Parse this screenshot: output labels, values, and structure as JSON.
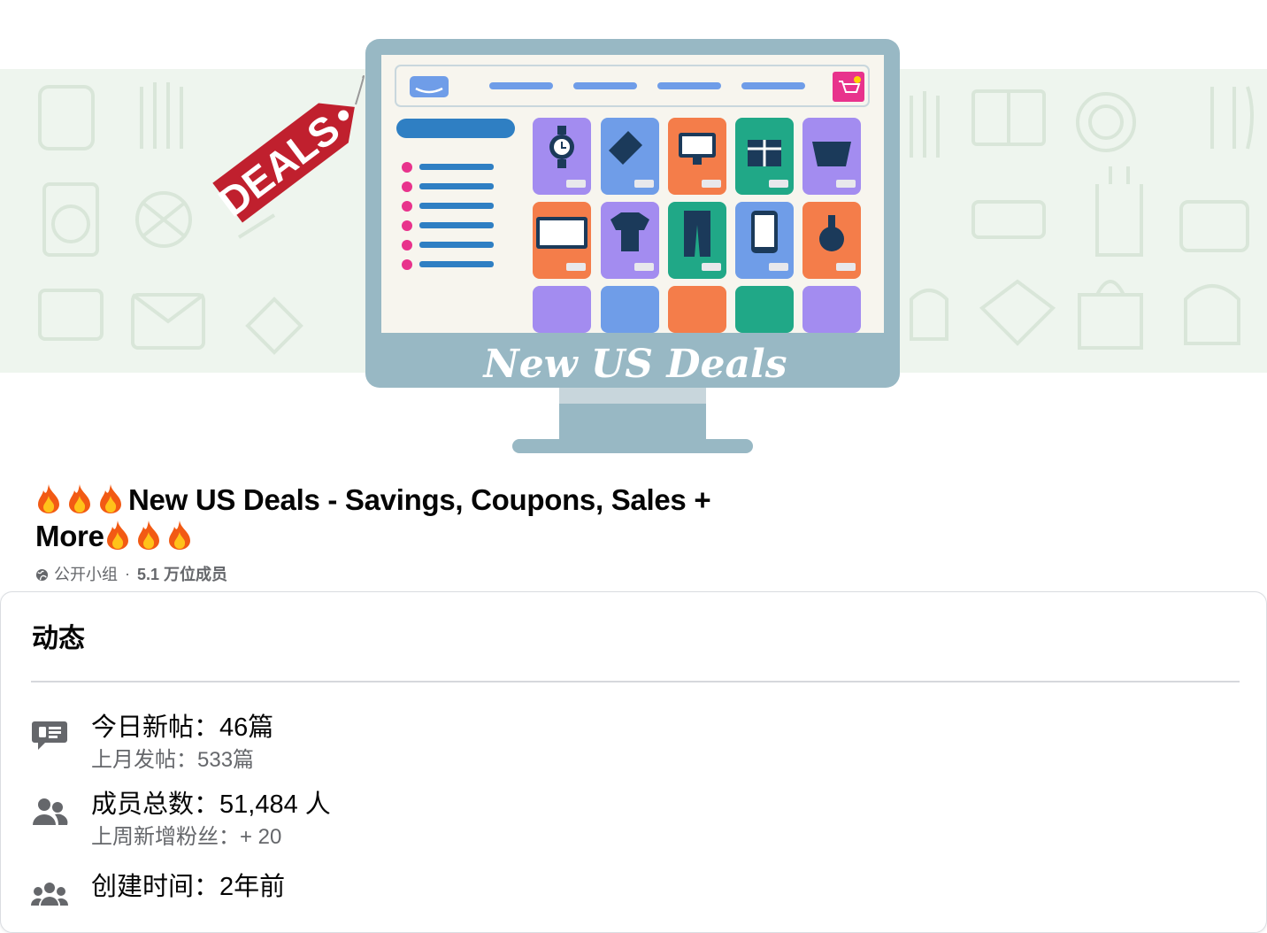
{
  "cover": {
    "tag_text": "DEALS",
    "screen_caption": "New US Deals"
  },
  "group": {
    "title_prefix_emoji": "🔥🔥🔥",
    "title_line1": "New US Deals - Savings, Coupons, Sales +",
    "title_line2": "More",
    "title_suffix_emoji": "🔥🔥🔥",
    "privacy": "公开小组",
    "separator": "·",
    "members": "5.1 万位成员"
  },
  "activity": {
    "heading": "动态",
    "stats": [
      {
        "icon": "speech-bubble-icon",
        "main": "今日新帖：46篇",
        "sub": "上月发帖：533篇"
      },
      {
        "icon": "people-icon",
        "main": "成员总数：51,484 人",
        "sub": "上周新增粉丝：+ 20"
      },
      {
        "icon": "group-icon",
        "main": "创建时间：2年前",
        "sub": ""
      }
    ]
  },
  "colors": {
    "band": "#eef5ee",
    "monitor_frame": "#98b8c4",
    "deals_tag": "#c0202e",
    "tile_purple": "#a38cf0",
    "tile_blue": "#6f9de8",
    "tile_orange": "#f47d4a",
    "tile_green": "#20a887",
    "accent_pink": "#e8338c",
    "text_primary": "#050505",
    "text_secondary": "#65676b"
  }
}
